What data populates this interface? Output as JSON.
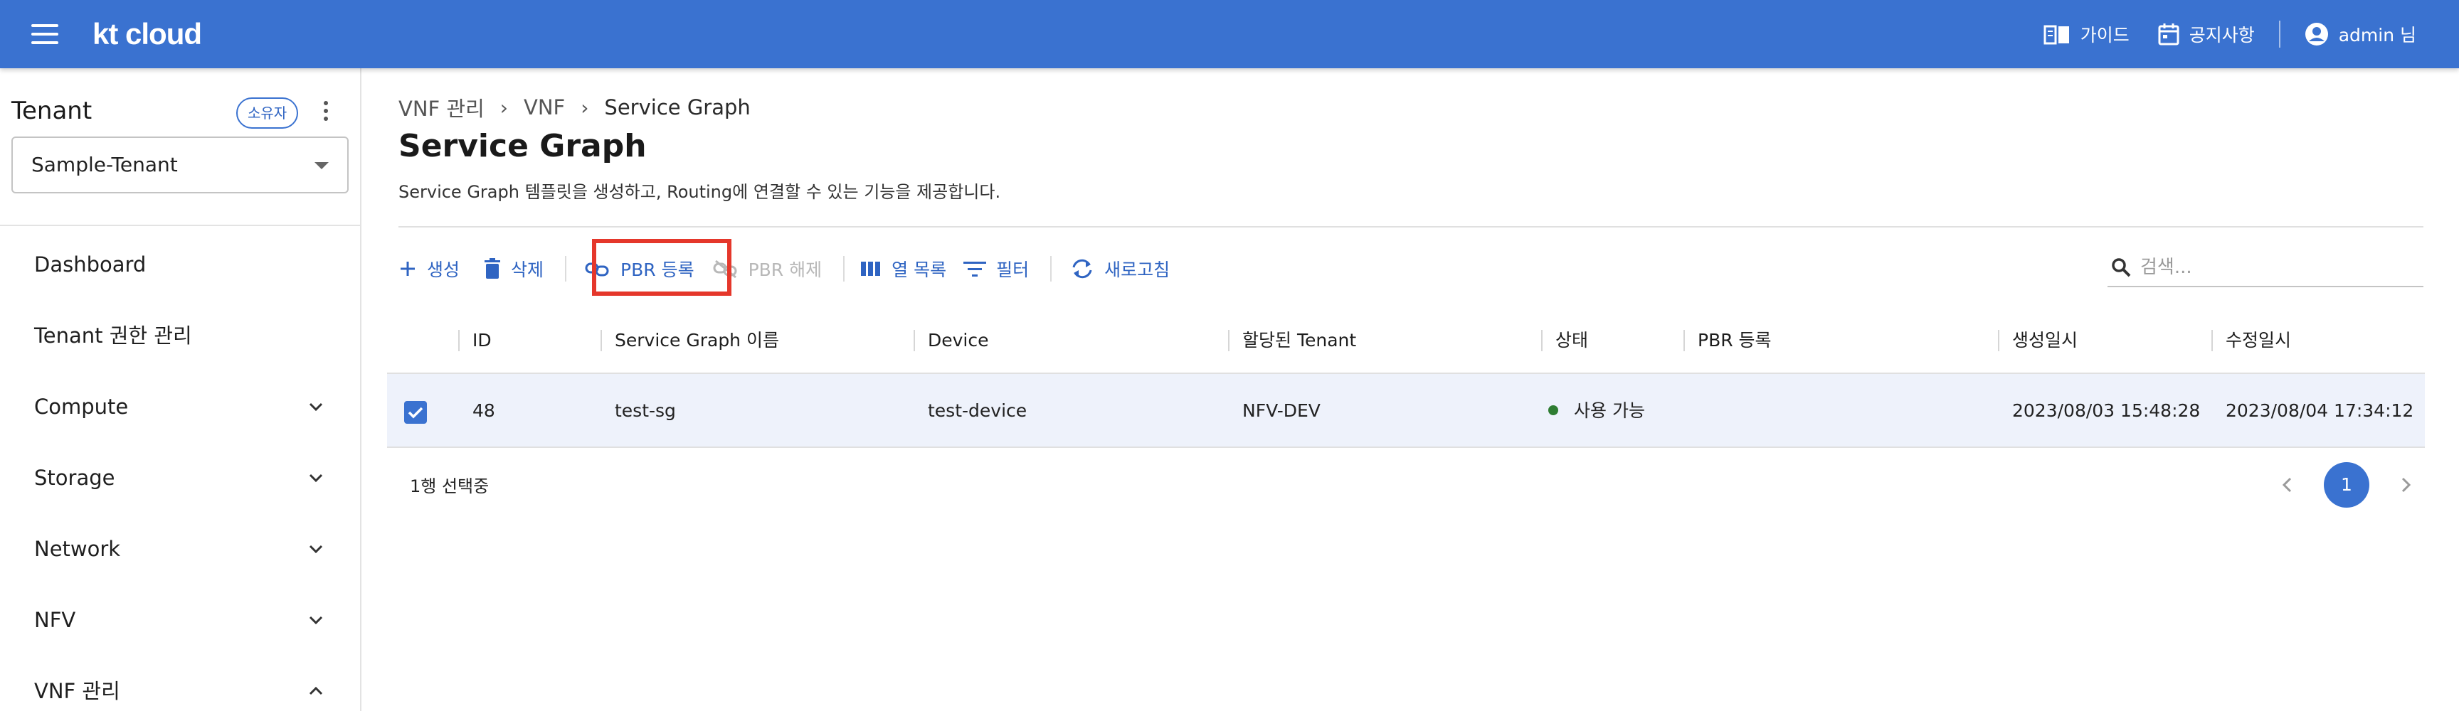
{
  "header": {
    "logo": "kt cloud",
    "guide_label": "가이드",
    "notice_label": "공지사항",
    "user_label": "admin 님"
  },
  "sidebar": {
    "tenant_label": "Tenant",
    "owner_chip": "소유자",
    "tenant_selected": "Sample-Tenant",
    "items": [
      {
        "label": "Dashboard",
        "expand": "none"
      },
      {
        "label": "Tenant 권한 관리",
        "expand": "none"
      },
      {
        "label": "Compute",
        "expand": "collapsed"
      },
      {
        "label": "Storage",
        "expand": "collapsed"
      },
      {
        "label": "Network",
        "expand": "collapsed"
      },
      {
        "label": "NFV",
        "expand": "collapsed"
      },
      {
        "label": "VNF 관리",
        "expand": "expanded"
      }
    ]
  },
  "breadcrumb": [
    "VNF 관리",
    "VNF",
    "Service Graph"
  ],
  "page": {
    "title": "Service Graph",
    "description": "Service Graph 템플릿을 생성하고, Routing에 연결할 수 있는 기능을 제공합니다."
  },
  "toolbar": {
    "create": "생성",
    "delete": "삭제",
    "pbr_register": "PBR 등록",
    "pbr_release": "PBR 해제",
    "columns": "열 목록",
    "filter": "필터",
    "refresh": "새로고침"
  },
  "search": {
    "placeholder": "검색...",
    "value": ""
  },
  "table": {
    "columns": [
      "ID",
      "Service Graph 이름",
      "Device",
      "할당된 Tenant",
      "상태",
      "PBR 등록",
      "생성일시",
      "수정일시"
    ],
    "rows": [
      {
        "selected": true,
        "id": "48",
        "name": "test-sg",
        "device": "test-device",
        "tenant": "NFV-DEV",
        "status": "사용 가능",
        "pbr": "",
        "created": "2023/08/03 15:48:28",
        "modified": "2023/08/04 17:34:12"
      }
    ]
  },
  "footer": {
    "selection_text": "1행 선택중",
    "current_page": "1"
  },
  "colors": {
    "brand": "#3a72d0",
    "highlight": "#e5372b",
    "status_ok": "#2e7d32",
    "selected_row": "#eef2fb"
  }
}
